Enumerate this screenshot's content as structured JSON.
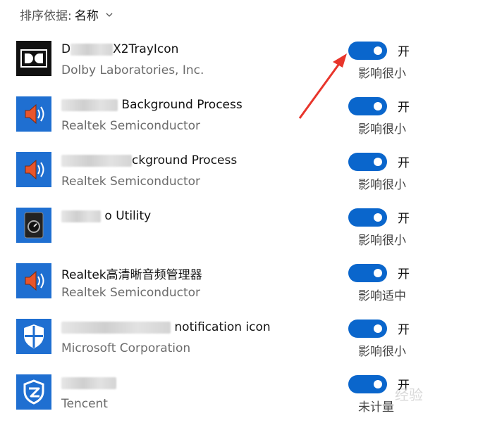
{
  "sort": {
    "label": "排序依据:",
    "value": "名称"
  },
  "apps": [
    {
      "name_visible": "X2TrayIcon",
      "name_prefix": "D",
      "publisher": "Dolby Laboratories, Inc.",
      "state": "开",
      "impact": "影响很小",
      "icon": "dolby-icon",
      "enabled": true
    },
    {
      "name_visible": "Background Process",
      "name_prefix": "",
      "publisher": "Realtek Semiconductor",
      "state": "开",
      "impact": "影响很小",
      "icon": "speaker-icon",
      "enabled": true
    },
    {
      "name_visible": "ckground Process",
      "name_prefix": "",
      "publisher": "Realtek Semiconductor",
      "state": "开",
      "impact": "影响很小",
      "icon": "speaker-icon",
      "enabled": true
    },
    {
      "name_visible": "o Utility",
      "name_prefix": "",
      "publisher": "",
      "state": "开",
      "impact": "影响很小",
      "icon": "utility-icon",
      "enabled": true
    },
    {
      "name_visible": "Realtek高清晰音频管理器",
      "name_prefix": "",
      "publisher": "Realtek Semiconductor",
      "state": "开",
      "impact": "影响适中",
      "icon": "speaker-icon",
      "enabled": true
    },
    {
      "name_visible": "notification icon",
      "name_prefix": "",
      "publisher": "Microsoft Corporation",
      "state": "开",
      "impact": "影响很小",
      "icon": "shield-icon",
      "enabled": true
    },
    {
      "name_visible": "",
      "name_prefix": "",
      "publisher": "Tencent",
      "state": "开",
      "impact": "未计量",
      "icon": "tencent-shield-icon",
      "enabled": true
    }
  ],
  "colors": {
    "toggle_on": "#0a66cc",
    "icon_bg": "#1f6fd1",
    "arrow": "#e8352b"
  },
  "watermark": "经验"
}
